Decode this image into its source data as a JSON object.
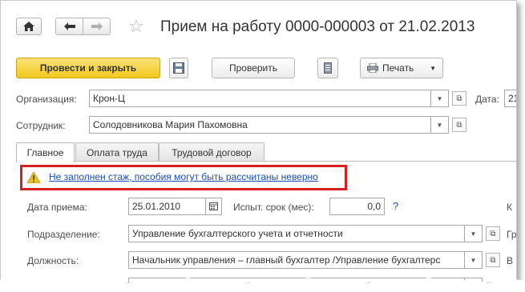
{
  "window": {
    "title": "Прием на работу 0000-000003 от 21.02.2013"
  },
  "toolbar": {
    "post_and_close": "Провести и закрыть",
    "check": "Проверить",
    "print": "Печать"
  },
  "fields": {
    "organization": {
      "label": "Организация:",
      "value": "Крон-Ц"
    },
    "date": {
      "label": "Дата:",
      "value": "21"
    },
    "employee": {
      "label": "Сотрудник:",
      "value": "Солодовникова Мария Пахомовна"
    }
  },
  "tabs": [
    "Главное",
    "Оплата труда",
    "Трудовой договор"
  ],
  "warning": {
    "text": "Не заполнен стаж, пособия могут быть рассчитаны неверно"
  },
  "main": {
    "hire_date": {
      "label": "Дата приема:",
      "value": "25.01.2010"
    },
    "probation": {
      "label": "Испыт. срок (мес):",
      "value": "0,0",
      "help": "?"
    },
    "right_cut_1": "К",
    "department": {
      "label": "Подразделение:",
      "value": "Управление бухгалтерского учета и отчетности"
    },
    "right_cut_2": "Гр",
    "position": {
      "label": "Должность:",
      "value": "Начальник управления – главный бухгалтер /Управление бухгалтерс"
    },
    "right_cut_3": "В"
  },
  "colors": {
    "primary_button": "#f2c81e",
    "warning_border": "#d62020",
    "link": "#1a4fb5"
  }
}
